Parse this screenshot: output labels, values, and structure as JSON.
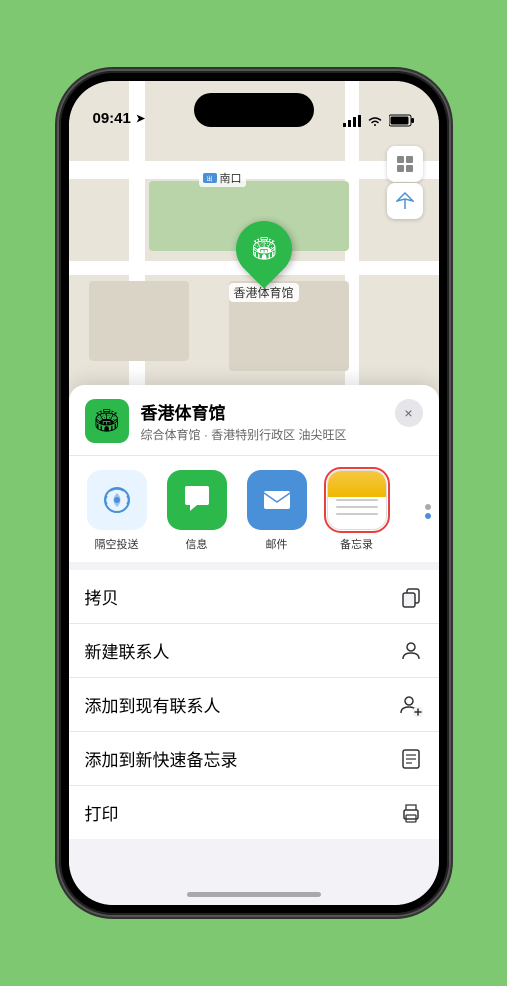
{
  "status": {
    "time": "09:41",
    "location_arrow": "▲"
  },
  "map": {
    "label_nankou": "南口",
    "label_nankou_prefix": "出口"
  },
  "pin": {
    "label": "香港体育馆"
  },
  "venue": {
    "name": "香港体育馆",
    "description": "综合体育馆 · 香港特别行政区 油尖旺区",
    "close_label": "×"
  },
  "share_items": [
    {
      "id": "airdrop",
      "label": "隔空投送"
    },
    {
      "id": "messages",
      "label": "信息"
    },
    {
      "id": "mail",
      "label": "邮件"
    },
    {
      "id": "notes",
      "label": "备忘录"
    }
  ],
  "actions": [
    {
      "label": "拷贝",
      "icon": "copy"
    },
    {
      "label": "新建联系人",
      "icon": "person"
    },
    {
      "label": "添加到现有联系人",
      "icon": "person-add"
    },
    {
      "label": "添加到新快速备忘录",
      "icon": "note"
    },
    {
      "label": "打印",
      "icon": "print"
    }
  ]
}
